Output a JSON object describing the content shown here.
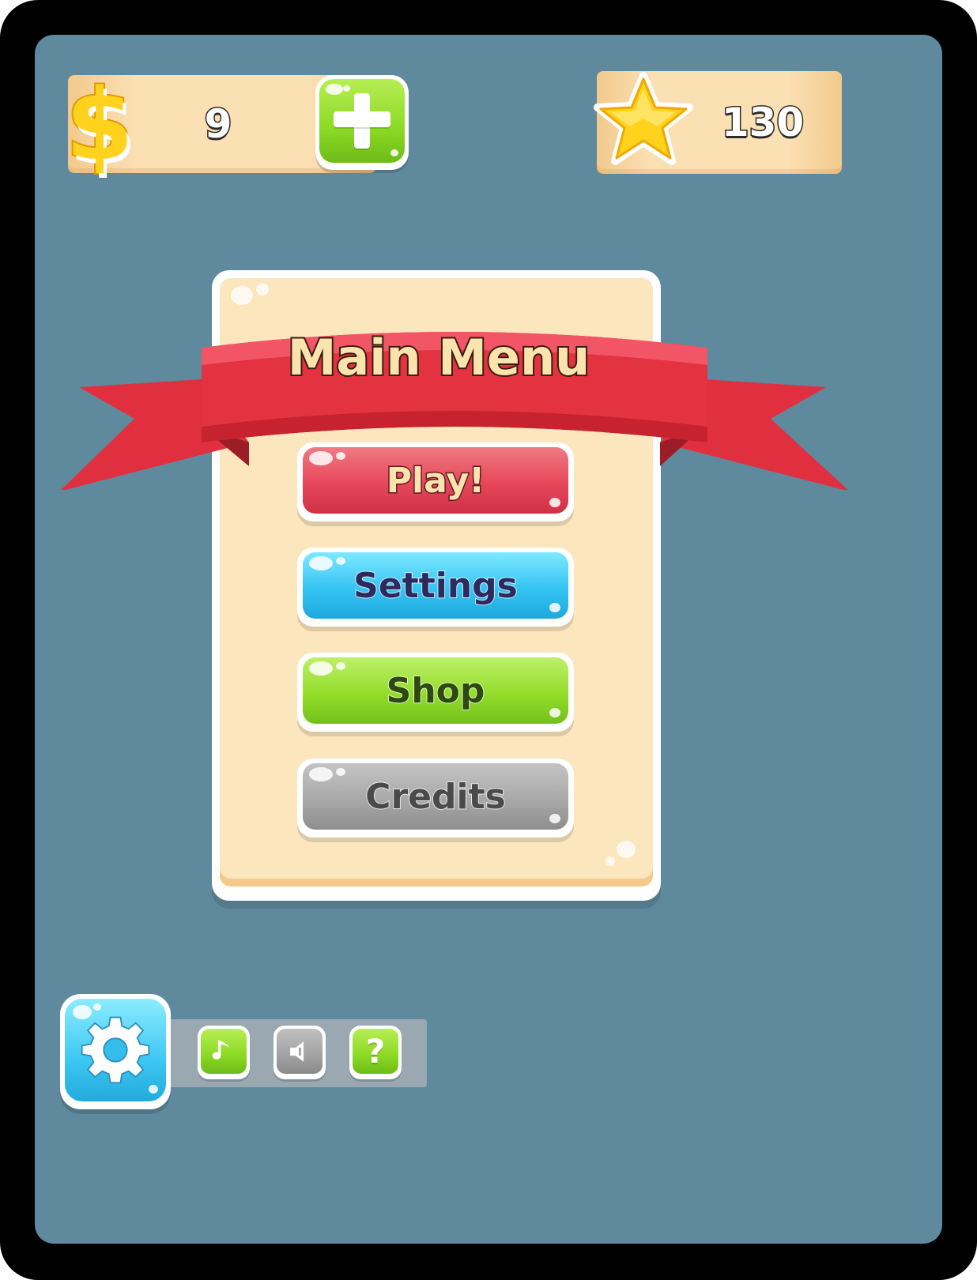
{
  "hud": {
    "coins": {
      "icon": "dollar-icon",
      "symbol": "$",
      "value": "9",
      "add_icon": "plus-icon"
    },
    "stars": {
      "icon": "star-icon",
      "value": "130"
    }
  },
  "main_menu": {
    "title": "Main Menu",
    "buttons": [
      {
        "label": "Play!",
        "color": "#e6475a"
      },
      {
        "label": "Settings",
        "color": "#35c4f3"
      },
      {
        "label": "Shop",
        "color": "#93dd2a"
      },
      {
        "label": "Credits",
        "color": "#a8a8a8"
      }
    ]
  },
  "quick_settings": {
    "main_icon": "gear-icon",
    "items": [
      {
        "icon": "music-note-icon"
      },
      {
        "icon": "speaker-icon"
      },
      {
        "icon": "help-icon",
        "glyph": "?"
      }
    ]
  },
  "colors": {
    "background": "#5f8a9e",
    "ribbon": "#e0303f",
    "panel": "#fbe6bd",
    "frame": "#000000"
  }
}
